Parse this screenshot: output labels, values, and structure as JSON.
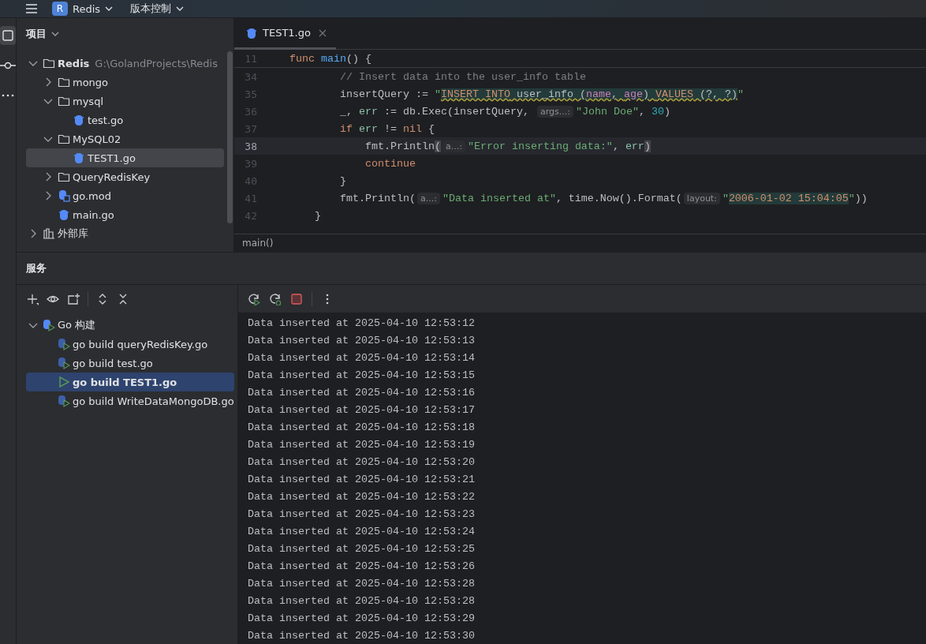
{
  "title_bar": {
    "project": {
      "badge": "R",
      "name": "Redis"
    },
    "vcs": "版本控制"
  },
  "tool_strip": [
    {
      "kind": "project",
      "selected": true
    },
    {
      "kind": "commit",
      "selected": false
    },
    {
      "kind": "more",
      "selected": false
    }
  ],
  "project_panel": {
    "title": "项目",
    "tree": [
      {
        "label": "Redis",
        "path": "G:\\GolandProjects\\Redis",
        "kind": "folder",
        "expanded": true,
        "selected": false,
        "children": [
          {
            "label": "mongo",
            "kind": "folder",
            "expanded": false,
            "selected": false
          },
          {
            "label": "mysql",
            "kind": "folder",
            "expanded": true,
            "selected": false,
            "children": [
              {
                "label": "test.go",
                "kind": "gofile",
                "selected": false
              }
            ]
          },
          {
            "label": "MySQL02",
            "kind": "folder",
            "expanded": true,
            "selected": false,
            "children": [
              {
                "label": "TEST1.go",
                "kind": "gofile",
                "selected": true
              }
            ]
          },
          {
            "label": "QueryRedisKey",
            "kind": "folder",
            "expanded": false,
            "selected": false
          },
          {
            "label": "go.mod",
            "kind": "gomod",
            "expanded": false,
            "selected": false
          },
          {
            "label": "main.go",
            "kind": "gofile",
            "selected": false
          }
        ]
      },
      {
        "label": "外部库",
        "kind": "library",
        "expanded": false,
        "selected": false
      }
    ]
  },
  "editor": {
    "tabs": [
      {
        "label": "TEST1.go",
        "selected": true
      }
    ],
    "sticky_line": {
      "number": "11",
      "current": false,
      "tokens": [
        {
          "text": "func ",
          "kind": "keyword"
        },
        {
          "text": "main",
          "kind": "function"
        },
        {
          "text": "() {",
          "kind": "plain"
        }
      ]
    },
    "lines": [
      {
        "number": "34",
        "current": false,
        "tokens": [
          {
            "text": "        // Insert data into the user_info table",
            "kind": "comment"
          }
        ]
      },
      {
        "number": "35",
        "current": false,
        "tokens": [
          {
            "text": "        insertQuery := ",
            "kind": "plain"
          },
          {
            "text": "\"",
            "kind": "string"
          },
          {
            "text": "INSERT INTO",
            "kind": "sql-keyword"
          },
          {
            "text": " user_info (",
            "kind": "sql-text"
          },
          {
            "text": "name",
            "kind": "sql-column"
          },
          {
            "text": ", ",
            "kind": "sql-text"
          },
          {
            "text": "age",
            "kind": "sql-column"
          },
          {
            "text": ") ",
            "kind": "sql-text"
          },
          {
            "text": "VALUES",
            "kind": "sql-keyword"
          },
          {
            "text": " (?, ?)",
            "kind": "sql-text"
          },
          {
            "text": "\"",
            "kind": "string"
          }
        ]
      },
      {
        "number": "36",
        "current": false,
        "tokens": [
          {
            "text": "        _, ",
            "kind": "plain"
          },
          {
            "text": "err",
            "kind": "variable"
          },
          {
            "text": " := db.Exec(insertQuery, ",
            "kind": "plain"
          },
          {
            "text": "args...:",
            "kind": "hint"
          },
          {
            "text": "\"John Doe\"",
            "kind": "string"
          },
          {
            "text": ", ",
            "kind": "plain"
          },
          {
            "text": "30",
            "kind": "number"
          },
          {
            "text": ")",
            "kind": "plain"
          }
        ]
      },
      {
        "number": "37",
        "current": false,
        "tokens": [
          {
            "text": "        if",
            "kind": "keyword"
          },
          {
            "text": " err",
            "kind": "variable"
          },
          {
            "text": " != ",
            "kind": "plain"
          },
          {
            "text": "nil",
            "kind": "keyword"
          },
          {
            "text": " {",
            "kind": "plain"
          }
        ]
      },
      {
        "number": "38",
        "current": true,
        "tokens": [
          {
            "text": "            fmt.Println",
            "kind": "plain"
          },
          {
            "text": "(",
            "kind": "brace-match"
          },
          {
            "text": "a...:",
            "kind": "hint"
          },
          {
            "text": "\"Error inserting data:\"",
            "kind": "string"
          },
          {
            "text": ", ",
            "kind": "plain"
          },
          {
            "text": "err",
            "kind": "variable"
          },
          {
            "text": ")",
            "kind": "brace-match"
          }
        ]
      },
      {
        "number": "39",
        "current": false,
        "tokens": [
          {
            "text": "            continue",
            "kind": "keyword"
          }
        ]
      },
      {
        "number": "40",
        "current": false,
        "tokens": [
          {
            "text": "        }",
            "kind": "plain"
          }
        ]
      },
      {
        "number": "41",
        "current": false,
        "tokens": [
          {
            "text": "        fmt.Println(",
            "kind": "plain"
          },
          {
            "text": "a...:",
            "kind": "hint"
          },
          {
            "text": "\"Data inserted at\"",
            "kind": "string"
          },
          {
            "text": ", time.Now().Format(",
            "kind": "plain"
          },
          {
            "text": "layout:",
            "kind": "hint"
          },
          {
            "text": "\"",
            "kind": "string"
          },
          {
            "text": "2006-01-02 15:04:05",
            "kind": "format"
          },
          {
            "text": "\"",
            "kind": "string"
          },
          {
            "text": "))",
            "kind": "plain"
          }
        ]
      },
      {
        "number": "42",
        "current": false,
        "tokens": [
          {
            "text": "    }",
            "kind": "plain"
          }
        ]
      }
    ],
    "breadcrumb": "main()"
  },
  "services": {
    "title": "服务",
    "toolbar": [
      {
        "kind": "add"
      },
      {
        "kind": "eye"
      },
      {
        "kind": "new-tab"
      },
      {
        "kind": "separator"
      },
      {
        "kind": "expand"
      },
      {
        "kind": "collapse"
      }
    ],
    "tree": [
      {
        "label": "Go 构建",
        "kind": "group",
        "expanded": true,
        "selected": false,
        "children": [
          {
            "label": "go build queryRedisKey.go",
            "kind": "config",
            "running": false,
            "selected": false
          },
          {
            "label": "go build test.go",
            "kind": "config",
            "running": false,
            "selected": false
          },
          {
            "label": "go build TEST1.go",
            "kind": "config",
            "running": true,
            "selected": true
          },
          {
            "label": "go build WriteDataMongoDB.go",
            "kind": "config",
            "running": false,
            "selected": false
          }
        ]
      }
    ],
    "console_toolbar": [
      {
        "kind": "rerun"
      },
      {
        "kind": "debug-rerun"
      },
      {
        "kind": "stop"
      },
      {
        "kind": "separator"
      },
      {
        "kind": "more"
      }
    ],
    "output": [
      "Data inserted at 2025-04-10 12:53:12",
      "Data inserted at 2025-04-10 12:53:13",
      "Data inserted at 2025-04-10 12:53:14",
      "Data inserted at 2025-04-10 12:53:15",
      "Data inserted at 2025-04-10 12:53:16",
      "Data inserted at 2025-04-10 12:53:17",
      "Data inserted at 2025-04-10 12:53:18",
      "Data inserted at 2025-04-10 12:53:19",
      "Data inserted at 2025-04-10 12:53:20",
      "Data inserted at 2025-04-10 12:53:21",
      "Data inserted at 2025-04-10 12:53:22",
      "Data inserted at 2025-04-10 12:53:23",
      "Data inserted at 2025-04-10 12:53:24",
      "Data inserted at 2025-04-10 12:53:25",
      "Data inserted at 2025-04-10 12:53:26",
      "Data inserted at 2025-04-10 12:53:28",
      "Data inserted at 2025-04-10 12:53:28",
      "Data inserted at 2025-04-10 12:53:29",
      "Data inserted at 2025-04-10 12:53:30"
    ]
  }
}
